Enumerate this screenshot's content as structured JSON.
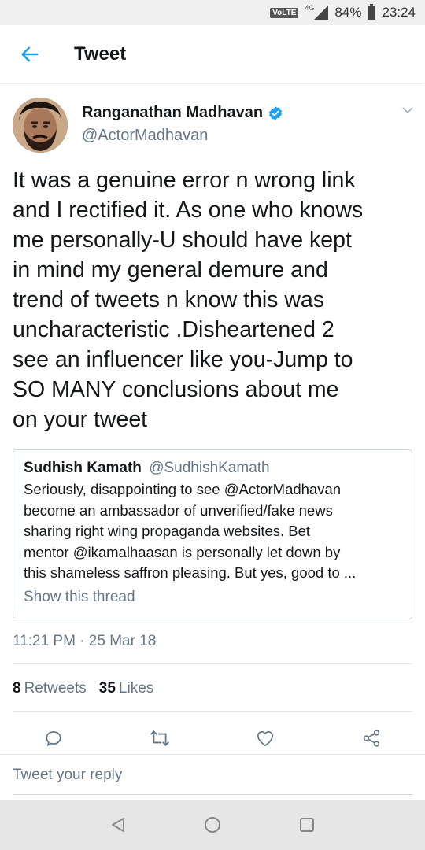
{
  "status_bar": {
    "volte": "VoLTE",
    "network": "4G",
    "battery": "84%",
    "time": "23:24"
  },
  "header": {
    "title": "Tweet"
  },
  "tweet": {
    "author_name": "Ranganathan Madhavan",
    "author_handle": "@ActorMadhavan",
    "verified": true,
    "text_lines": [
      "It was a genuine error n wrong link",
      "and I rectified it. As one who knows",
      "me personally-U should have kept",
      "in mind  my general demure  and",
      "trend of tweets n know this was",
      "uncharacteristic .Disheartened 2",
      "see an influencer like you-Jump to",
      "SO MANY conclusions about me",
      "on your tweet"
    ],
    "timestamp": "11:21 PM · 25 Mar 18",
    "retweets_count": "8",
    "retweets_label": "Retweets",
    "likes_count": "35",
    "likes_label": "Likes"
  },
  "quoted_tweet": {
    "author_name": "Sudhish Kamath",
    "author_handle": "@SudhishKamath",
    "text_lines": [
      "Seriously, disappointing to see @ActorMadhavan",
      "become an ambassador of unverified/fake news",
      "sharing right wing propaganda websites. Bet",
      "mentor @ikamalhaasan is personally let down by",
      "this shameless saffron pleasing. But yes, good to ..."
    ],
    "show_thread": "Show this thread"
  },
  "reply": {
    "placeholder": "Tweet your reply"
  },
  "colors": {
    "accent": "#1da1f2",
    "secondary_text": "#657786",
    "primary_text": "#14171a"
  },
  "icons": [
    "back-arrow-icon",
    "verified-badge-icon",
    "chevron-down-icon",
    "reply-icon",
    "retweet-icon",
    "like-icon",
    "share-icon",
    "nav-back-icon",
    "nav-home-icon",
    "nav-recents-icon"
  ]
}
